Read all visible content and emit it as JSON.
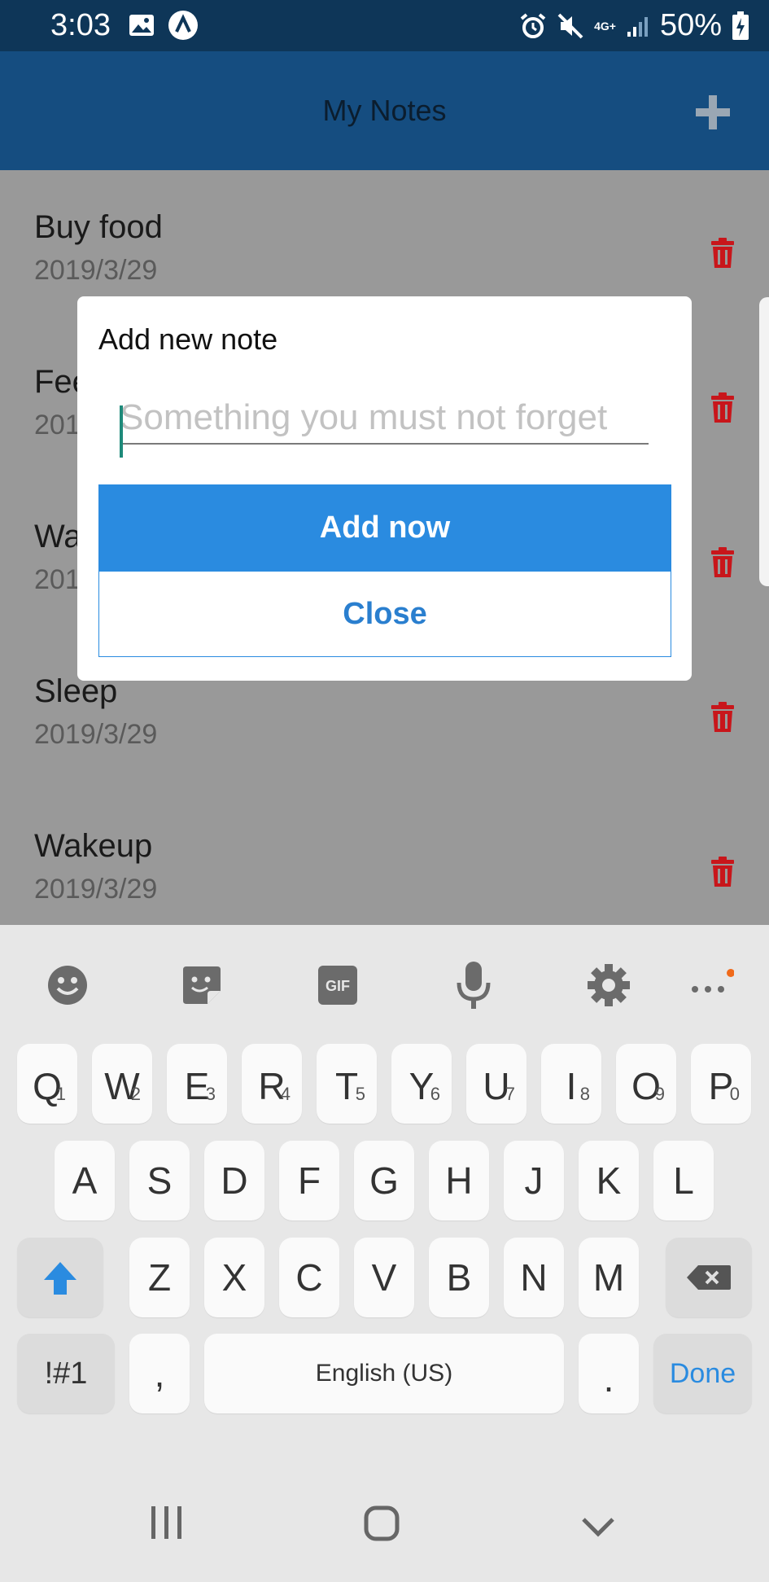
{
  "status_bar": {
    "time": "3:03",
    "battery": "50%",
    "network": "4G+"
  },
  "app_bar": {
    "title": "My Notes"
  },
  "notes": [
    {
      "title": "Buy food",
      "date": "2019/3/29"
    },
    {
      "title": "Fee",
      "date": "201"
    },
    {
      "title": "Wa",
      "date": "201"
    },
    {
      "title": "Sleep",
      "date": "2019/3/29"
    },
    {
      "title": "Wakeup",
      "date": "2019/3/29"
    }
  ],
  "dialog": {
    "title": "Add new note",
    "placeholder": "Something you must not forget",
    "add_button": "Add now",
    "close_button": "Close"
  },
  "keyboard": {
    "toolbar_icons": [
      "emoji-icon",
      "sticker-icon",
      "gif-icon",
      "microphone-icon",
      "settings-icon",
      "more-icon"
    ],
    "gif_label": "GIF",
    "row1": [
      {
        "k": "Q",
        "h": "1"
      },
      {
        "k": "W",
        "h": "2"
      },
      {
        "k": "E",
        "h": "3"
      },
      {
        "k": "R",
        "h": "4"
      },
      {
        "k": "T",
        "h": "5"
      },
      {
        "k": "Y",
        "h": "6"
      },
      {
        "k": "U",
        "h": "7"
      },
      {
        "k": "I",
        "h": "8"
      },
      {
        "k": "O",
        "h": "9"
      },
      {
        "k": "P",
        "h": "0"
      }
    ],
    "row2": [
      "A",
      "S",
      "D",
      "F",
      "G",
      "H",
      "J",
      "K",
      "L"
    ],
    "row3": [
      "Z",
      "X",
      "C",
      "V",
      "B",
      "N",
      "M"
    ],
    "symbols": "!#1",
    "comma": ",",
    "space": "English (US)",
    "period": ".",
    "done": "Done"
  },
  "colors": {
    "accent": "#2a8be0",
    "appbar": "#154d80",
    "statusbar": "#0e3658",
    "trash": "#c8161b"
  }
}
